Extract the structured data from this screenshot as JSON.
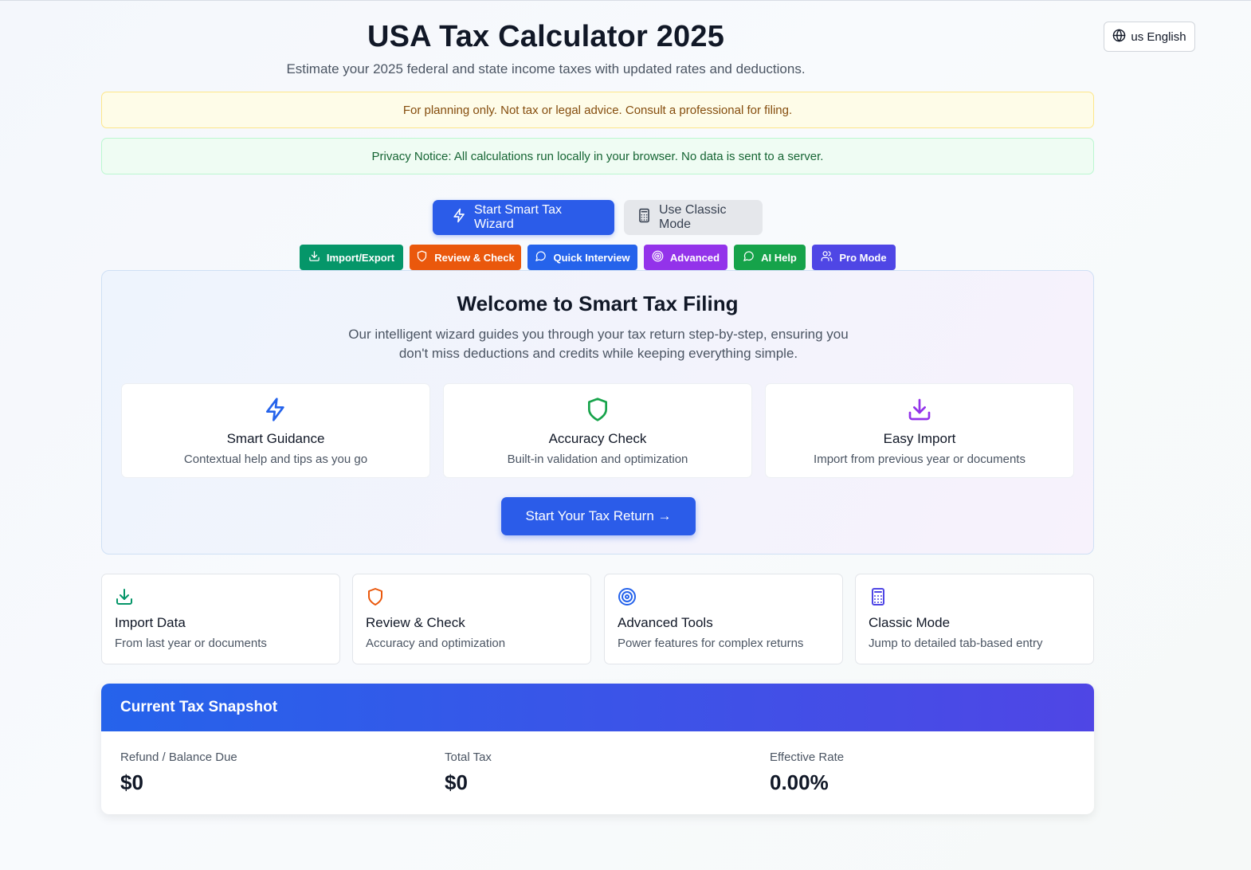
{
  "header": {
    "title": "USA Tax Calculator 2025",
    "subtitle": "Estimate your 2025 federal and state income taxes with updated rates and deductions.",
    "language_label": "us English"
  },
  "notices": {
    "disclaimer": "For planning only. Not tax or legal advice. Consult a professional for filing.",
    "privacy": "Privacy Notice: All calculations run locally in your browser. No data is sent to a server."
  },
  "modes": {
    "wizard_label": "Start Smart Tax Wizard",
    "classic_label": "Use Classic Mode"
  },
  "quick_actions": [
    {
      "label": "Import/Export",
      "color": "#059669",
      "icon": "download-icon"
    },
    {
      "label": "Review & Check",
      "color": "#ea580c",
      "icon": "shield-icon"
    },
    {
      "label": "Quick Interview",
      "color": "#2563eb",
      "icon": "chat-bubble-icon"
    },
    {
      "label": "Advanced",
      "color": "#9333ea",
      "icon": "target-icon"
    },
    {
      "label": "AI Help",
      "color": "#16a34a",
      "icon": "chat-bubble-icon"
    },
    {
      "label": "Pro Mode",
      "color": "#4f46e5",
      "icon": "users-icon"
    }
  ],
  "welcome": {
    "title": "Welcome to Smart Tax Filing",
    "description": "Our intelligent wizard guides you through your tax return step-by-step, ensuring you don't miss deductions and credits while keeping everything simple.",
    "features": [
      {
        "title": "Smart Guidance",
        "description": "Contextual help and tips as you go",
        "icon": "lightning-icon",
        "color": "#2563eb"
      },
      {
        "title": "Accuracy Check",
        "description": "Built-in validation and optimization",
        "icon": "shield-icon",
        "color": "#16a34a"
      },
      {
        "title": "Easy Import",
        "description": "Import from previous year or documents",
        "icon": "download-icon",
        "color": "#9333ea"
      }
    ],
    "start_button": "Start Your Tax Return →"
  },
  "quick_cards": [
    {
      "title": "Import Data",
      "description": "From last year or documents",
      "icon": "download-icon",
      "color": "#059669"
    },
    {
      "title": "Review & Check",
      "description": "Accuracy and optimization",
      "icon": "shield-icon",
      "color": "#ea580c"
    },
    {
      "title": "Advanced Tools",
      "description": "Power features for complex returns",
      "icon": "target-icon",
      "color": "#2563eb"
    },
    {
      "title": "Classic Mode",
      "description": "Jump to detailed tab-based entry",
      "icon": "calculator-icon",
      "color": "#4f46e5"
    }
  ],
  "snapshot": {
    "title": "Current Tax Snapshot",
    "stats": [
      {
        "label": "Refund / Balance Due",
        "value": "$0"
      },
      {
        "label": "Total Tax",
        "value": "$0"
      },
      {
        "label": "Effective Rate",
        "value": "0.00%"
      }
    ]
  }
}
